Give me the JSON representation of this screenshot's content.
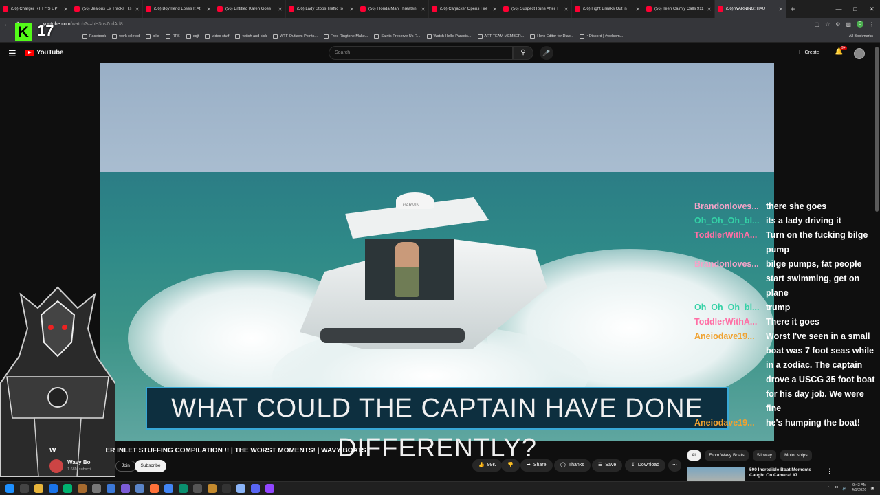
{
  "browser": {
    "tabs": [
      {
        "label": "(56) Charger RT F**S UP",
        "active": false
      },
      {
        "label": "(56) Jealous Ex Tracks His",
        "active": false
      },
      {
        "label": "(56) Boyfriend Loses It At",
        "active": false
      },
      {
        "label": "(56) Entitled Karen Goes",
        "active": false
      },
      {
        "label": "(56) Lady Stops Traffic to",
        "active": false
      },
      {
        "label": "(56) Florida Man Threaten",
        "active": false
      },
      {
        "label": "(56) Carjacker Opens Fire",
        "active": false
      },
      {
        "label": "(56) Suspect Runs After T",
        "active": false
      },
      {
        "label": "(56) Fight Breaks Out in",
        "active": false
      },
      {
        "label": "(56) Teen Calmly Calls 911",
        "active": false
      },
      {
        "label": "(56) WARNING: HAU",
        "active": true
      }
    ],
    "url_host": "youtube.com",
    "url_path": "/watch?v=hH3ns7qdAd8",
    "profile_initial": "E",
    "bookmarks": [
      "Facebook",
      "work releted",
      "bills",
      "RFS",
      "eqjt",
      "video stuff",
      "twitch and kick",
      "WTF Outlaws Points...",
      "Free Ringtone Make...",
      "Saints Preserve Us R...",
      "Watch Hell's Paradis...",
      "ART TEAM MEMBER...",
      "Hero Editor for Diab...",
      "• Discord | #welcom..."
    ],
    "all_bookmarks": "All Bookmarks",
    "bookmark_stuff": "stuff"
  },
  "overlay": {
    "kick_letter": "K",
    "viewer_count": "17"
  },
  "youtube": {
    "logo": "YouTube",
    "search_placeholder": "Search",
    "create_label": "Create",
    "notif_badge": "9+"
  },
  "video": {
    "caption": "WHAT COULD THE CAPTAIN HAVE DONE DIFFERENTLY?",
    "dome_label": "GARMIN",
    "title": "ER INLET STUFFING COMPILATION !! | THE WORST MOMENTS! | WAVY BOATS",
    "title_prefix": "W",
    "channel": "Wavy Bo",
    "subscribers": "1.68M subscri",
    "join_label": "Join",
    "subscribe_label": "Subscribe",
    "likes": "99K",
    "share_label": "Share",
    "thanks_label": "Thanks",
    "save_label": "Save",
    "download_label": "Download"
  },
  "chat": [
    {
      "user": "Brandonloves...",
      "text": "there she goes",
      "color": "#f4a3c8"
    },
    {
      "user": "Oh_Oh_Oh_bl...",
      "text": "its a lady driving it",
      "color": "#34d1a6"
    },
    {
      "user": "ToddlerWithA...",
      "text": "Turn on the fucking bilge pump",
      "color": "#ff6fa5"
    },
    {
      "user": "Brandonloves...",
      "text": "bilge pumps, fat people start swimming, get on plane",
      "color": "#f4a3c8"
    },
    {
      "user": "Oh_Oh_Oh_bl...",
      "text": "trump",
      "color": "#34d1a6"
    },
    {
      "user": "ToddlerWithA...",
      "text": "There it goes",
      "color": "#ff6fa5"
    },
    {
      "user": "Aneiodave19...",
      "text": "Worst I've seen in a small boat was 7 foot seas while in a zodiac. The captain drove a USCG 35 foot boat for his day job. We were fine",
      "color": "#f0a230"
    },
    {
      "user": "Aneiodave19...",
      "text": "he's humping the boat!",
      "color": "#f0a230"
    }
  ],
  "sidebar": {
    "chips": [
      "All",
      "From Wavy Boats",
      "Slipway",
      "Motor ships"
    ],
    "reco_title": "500 Incredible Boat Moments Caught On Camera! #7"
  },
  "taskbar": {
    "time": "9:43 AM",
    "date": "4/1/2026"
  }
}
